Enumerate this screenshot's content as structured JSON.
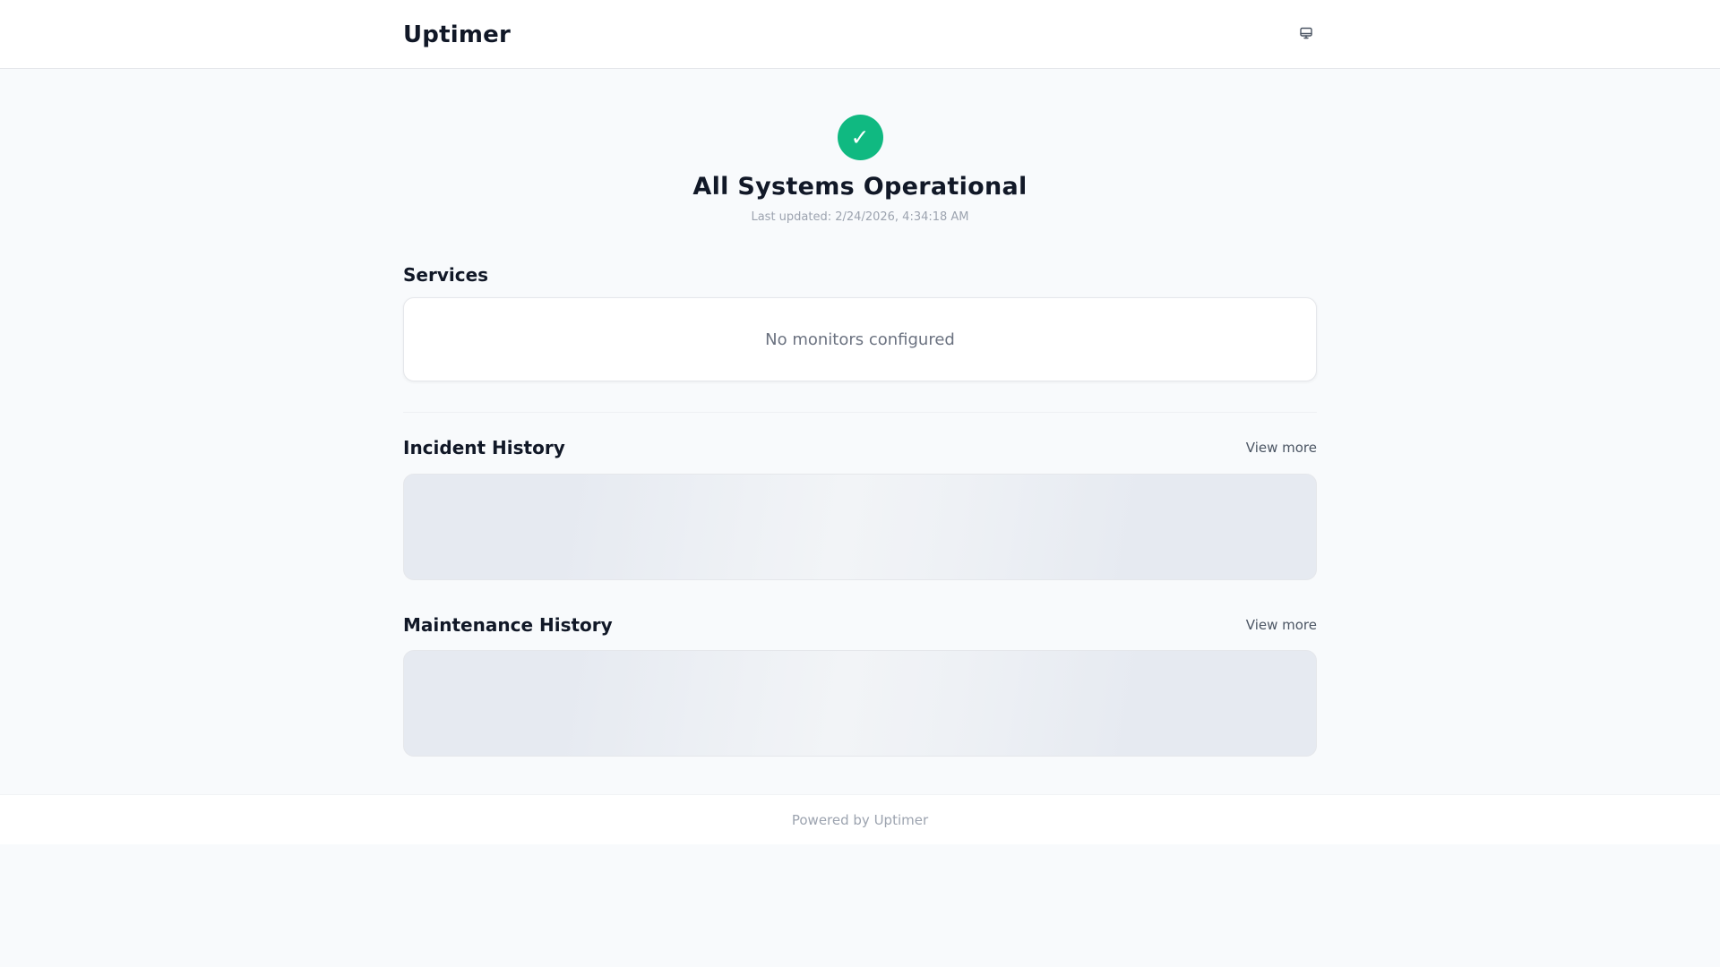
{
  "header": {
    "brand": "Uptimer",
    "theme_toggle_icon": "monitor-icon"
  },
  "status": {
    "icon": "check-icon",
    "title": "All Systems Operational",
    "last_updated": "Last updated: 2/24/2026, 4:34:18 AM",
    "color": "#10b981"
  },
  "services": {
    "title": "Services",
    "empty_message": "No monitors configured"
  },
  "incidents": {
    "title": "Incident History",
    "view_more": "View more"
  },
  "maintenance": {
    "title": "Maintenance History",
    "view_more": "View more"
  },
  "footer": {
    "text": "Powered by Uptimer"
  }
}
